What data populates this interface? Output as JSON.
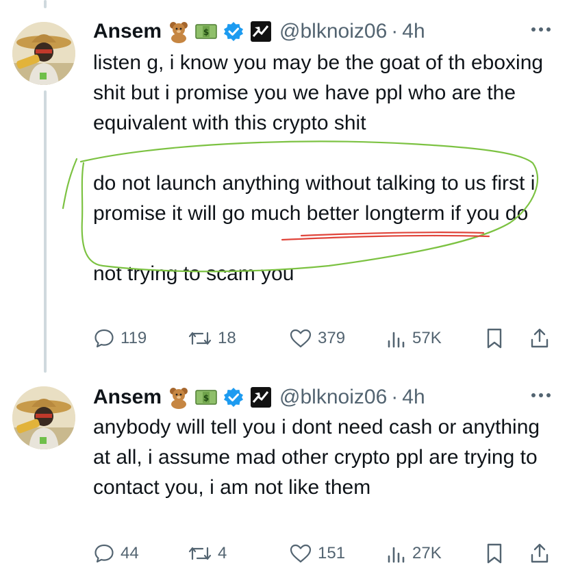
{
  "tweets": [
    {
      "author": {
        "name": "Ansem",
        "handle": "@blknoiz06",
        "time": "4h",
        "separator": "·",
        "badges": [
          "teddy-bear-emoji",
          "money-emoji",
          "verified-badge",
          "trading-logo"
        ]
      },
      "paragraphs": [
        "listen g, i know you may be the goat of th eboxing shit but i promise you we have ppl who are the equivalent with this crypto shit",
        "do not launch anything without talking to us first i promise it will go much better longterm if you do",
        "not trying to scam you"
      ],
      "stats": {
        "replies": "119",
        "reposts": "18",
        "likes": "379",
        "views": "57K"
      }
    },
    {
      "author": {
        "name": "Ansem",
        "handle": "@blknoiz06",
        "time": "4h",
        "separator": "·",
        "badges": [
          "teddy-bear-emoji",
          "money-emoji",
          "verified-badge",
          "trading-logo"
        ]
      },
      "paragraphs": [
        "anybody will tell you i dont need cash or anything at all, i assume mad other crypto ppl are trying to contact you, i am not like them"
      ],
      "stats": {
        "replies": "44",
        "reposts": "4",
        "likes": "151",
        "views": "27K"
      }
    }
  ],
  "colors": {
    "text": "#0f1419",
    "secondary": "#536471",
    "verified": "#1d9bf0",
    "thread_line": "#cfd9de",
    "annotation_circle": "#7cc242",
    "annotation_underline": "#e0443a"
  }
}
